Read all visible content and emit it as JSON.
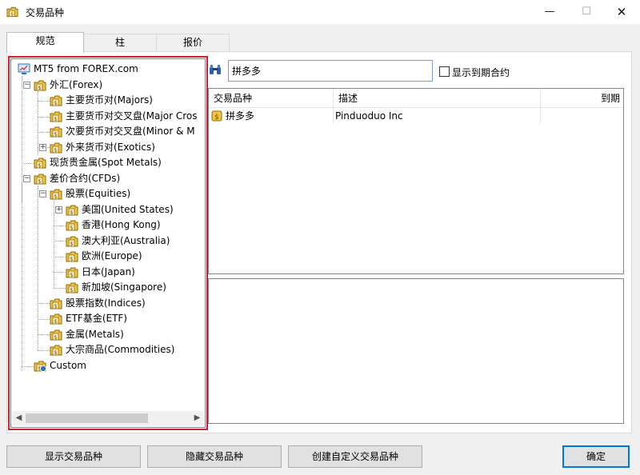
{
  "window": {
    "title": "交易品种",
    "minimize": "—",
    "maximize": "☐",
    "close": "✕"
  },
  "tabs": [
    "规范",
    "柱",
    "报价"
  ],
  "tree": {
    "root": "MT5 from FOREX.com",
    "forex": "外汇(Forex)",
    "majors": "主要货币对(Majors)",
    "major_crosses": "主要货币对交叉盘(Major Cros",
    "minor_crosses": "次要货币对交叉盘(Minor & M",
    "exotics": "外来货币对(Exotics)",
    "spot_metals": "现货贵金属(Spot Metals)",
    "cfds": "差价合约(CFDs)",
    "equities": "股票(Equities)",
    "united_states": "美国(United States)",
    "hong_kong": "香港(Hong Kong)",
    "australia": "澳大利亚(Australia)",
    "europe": "欧洲(Europe)",
    "japan": "日本(Japan)",
    "singapore": "新加坡(Singapore)",
    "indices": "股票指数(Indices)",
    "etf": "ETF基金(ETF)",
    "metals": "金属(Metals)",
    "commodities": "大宗商品(Commodities)",
    "custom": "Custom"
  },
  "scrollbar": {
    "left": "◀",
    "right": "▶"
  },
  "search": {
    "value": "拼多多"
  },
  "show_expired": {
    "label": "显示到期合约",
    "checked": false
  },
  "grid": {
    "columns": [
      "交易品种",
      "描述",
      "到期"
    ],
    "rows": [
      {
        "symbol": "拼多多",
        "description": "Pinduoduo Inc",
        "expiry": ""
      }
    ]
  },
  "buttons": {
    "show": "显示交易品种",
    "hide": "隐藏交易品种",
    "create": "创建自定义交易品种",
    "ok": "确定"
  },
  "colors": {
    "highlight_border": "#d21f2a",
    "folder": "#f3c43c",
    "accent": "#0078d7"
  }
}
